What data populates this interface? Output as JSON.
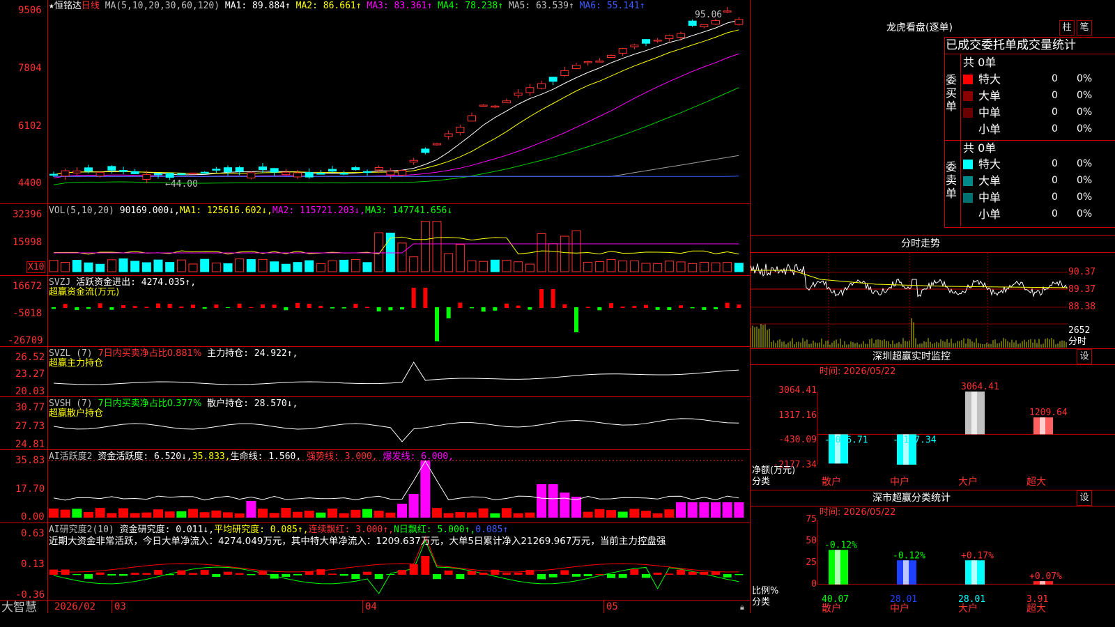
{
  "stock": {
    "star": "★",
    "name": "恒铭达",
    "period": "日线",
    "ma_header": "MA(5,10,20,30,60,120)",
    "ma_values": [
      {
        "label": "MA1:",
        "value": "89.884↑",
        "color": "#ffffff"
      },
      {
        "label": "MA2:",
        "value": "86.661↑",
        "color": "#ffff00"
      },
      {
        "label": "MA3:",
        "value": "83.361↑",
        "color": "#ff00ff"
      },
      {
        "label": "MA4:",
        "value": "78.238↑",
        "color": "#00ff00"
      },
      {
        "label": "MA5:",
        "value": "63.539↑",
        "color": "#c0c0c0"
      },
      {
        "label": "MA6:",
        "value": "55.141↑",
        "color": "#3a5bff"
      }
    ],
    "high_label": "95.06",
    "low_label": "←44.00"
  },
  "axes": {
    "price": [
      "9506",
      "7804",
      "6102",
      "4400"
    ],
    "vol": [
      "32396",
      "15998",
      "X10"
    ],
    "svzj": [
      "16672",
      "-5018",
      "-26709"
    ],
    "svzl": [
      "26.52",
      "23.27",
      "20.03"
    ],
    "svsh": [
      "30.77",
      "27.73",
      "24.81"
    ],
    "ai": [
      "35.83",
      "17.70",
      "0.00"
    ],
    "air": [
      "0.63",
      "0.13",
      "-0.36"
    ],
    "dates": [
      "2026/02",
      "03",
      "04",
      "05"
    ]
  },
  "vol_panel": {
    "title": "VOL(5,10,20)",
    "value": "90169.000↓,",
    "ma1": "MA1: 125616.602↓,",
    "ma2": "MA2: 115721.203↓,",
    "ma3": "MA3: 147741.656↓"
  },
  "svzj_panel": {
    "title": "SVZJ",
    "label": "活跃资金进出: 4274.035↑,",
    "sub": "超赢资金流(万元)"
  },
  "svzl_panel": {
    "title": "SVZL (7)",
    "ratio": "7日内买卖净占比0.881%",
    "label": "主力持仓: 24.922↑,",
    "sub": "超赢主力持仓"
  },
  "svsh_panel": {
    "title": "SVSH (7)",
    "ratio": "7日内买卖净占比0.377%",
    "label": "散户持仓: 28.570↓,",
    "sub": "超赢散户持仓"
  },
  "ai_panel": {
    "title": "AI活跃度2",
    "label": "资金活跃度: 6.520↓,",
    "v2": "35.833,",
    "life": "生命线: 1.560,",
    "strong": "强势线: 3.000,",
    "burst": "爆发线: 6.000,"
  },
  "air_panel": {
    "title": "AI研究度2(10)",
    "label": "资金研究度: 0.011↓,",
    "avg": "平均研究度: 0.085↑,",
    "cont": "连续飘红: 3.000↑,",
    "nday": "N日飘红: 5.000↑,",
    "last": "0.085↑",
    "comment": "近期大资金非常活跃，今日大单净流入：4274.049万元，其中特大单净流入：1209.637万元，大单5日累计净入21269.967万元，当前主力控盘强"
  },
  "footer": {
    "brand": "大智慧"
  },
  "lhb": {
    "title": "龙虎看盘(逐单)",
    "btn1": "柱",
    "btn2": "笔",
    "tabs": "已成交委托单成交量统计",
    "buy_side": "委买单",
    "sell_side": "委卖单",
    "buy_total": "共 0单",
    "sell_total": "共 0单",
    "buy_rows": [
      {
        "name": "特大",
        "count": "0",
        "pct": "0%",
        "color": "#ff0000"
      },
      {
        "name": "大单",
        "count": "0",
        "pct": "0%",
        "color": "#8b0000"
      },
      {
        "name": "中单",
        "count": "0",
        "pct": "0%",
        "color": "#6b0000"
      },
      {
        "name": "小单",
        "count": "0",
        "pct": "0%",
        "color": "#000000"
      }
    ],
    "sell_rows": [
      {
        "name": "特大",
        "count": "0",
        "pct": "0%",
        "color": "#00ffff"
      },
      {
        "name": "大单",
        "count": "0",
        "pct": "0%",
        "color": "#008b8b"
      },
      {
        "name": "中单",
        "count": "0",
        "pct": "0%",
        "color": "#007070"
      },
      {
        "name": "小单",
        "count": "0",
        "pct": "0%",
        "color": "#000000"
      }
    ]
  },
  "intraday": {
    "title": "分时走势",
    "prices": [
      "90.37",
      "89.37",
      "88.38"
    ],
    "vol": "2652",
    "unit": "分时"
  },
  "szmonitor": {
    "title": "深圳超赢实时监控",
    "btn": "设",
    "time": "时间: 2026/05/22",
    "yticks": [
      "3064.41",
      "1317.16",
      "-430.09",
      "-2177.34"
    ],
    "ylabel": "净额(万元)",
    "xlabel": "分类",
    "categories": [
      "散户",
      "中户",
      "大户",
      "超大"
    ],
    "values": [
      "-2096.71",
      "-2177.34",
      "3064.41",
      "1209.64"
    ]
  },
  "szclass": {
    "title": "深市超赢分类统计",
    "btn": "设",
    "time": "时间: 2026/05/22",
    "yticks": [
      "75",
      "50",
      "25",
      "0"
    ],
    "ylabel": "比例%",
    "xlabel": "分类",
    "categories": [
      "散户",
      "中户",
      "大户",
      "超大"
    ],
    "pcts": [
      "40.07",
      "28.01",
      "28.01",
      "3.91"
    ],
    "changes": [
      "-0.12%",
      "-0.12%",
      "+0.17%",
      "+0.07%"
    ]
  },
  "chart_data": [
    {
      "type": "bar",
      "title": "深圳超赢实时监控",
      "ylabel": "净额(万元)",
      "xlabel": "分类",
      "categories": [
        "散户",
        "中户",
        "大户",
        "超大"
      ],
      "values": [
        -2096.71,
        -2177.34,
        3064.41,
        1209.64
      ],
      "ylim": [
        -2177.34,
        3064.41
      ]
    },
    {
      "type": "bar",
      "title": "深市超赢分类统计",
      "ylabel": "比例%",
      "xlabel": "分类",
      "categories": [
        "散户",
        "中户",
        "大户",
        "超大"
      ],
      "values": [
        40.07,
        28.01,
        28.01,
        3.91
      ],
      "changes": [
        "-0.12%",
        "-0.12%",
        "+0.17%",
        "+0.07%"
      ],
      "ylim": [
        0,
        75
      ]
    }
  ]
}
